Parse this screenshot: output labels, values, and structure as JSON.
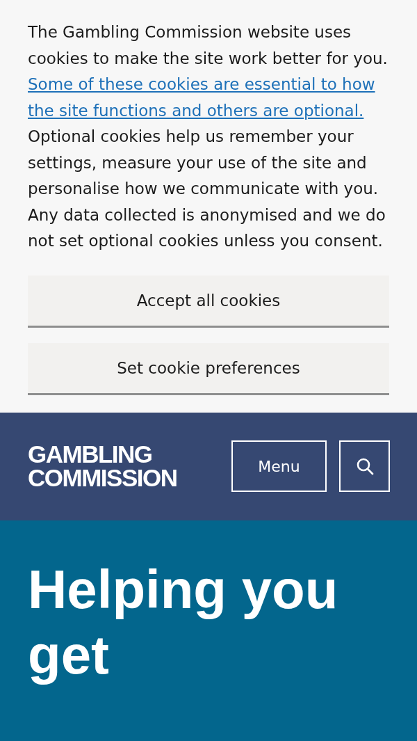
{
  "cookie_banner": {
    "text_before": "The Gambling Commission website uses cookies to make the site work better for you.",
    "link": "Some of these cookies are essential to how the site functions and others are optional.",
    "text_after": "Optional cookies help us remember your settings, measure your use of the site and personalise how we communicate with you. Any data collected is anonymised and we do not set optional cookies unless you consent.",
    "buttons": [
      "Accept all cookies",
      "Set cookie preferences"
    ]
  },
  "header": {
    "logo": [
      "GAMBLING",
      "COMMISSION"
    ],
    "menu_button": "Menu"
  },
  "hero": {
    "heading": "Helping you get"
  }
}
